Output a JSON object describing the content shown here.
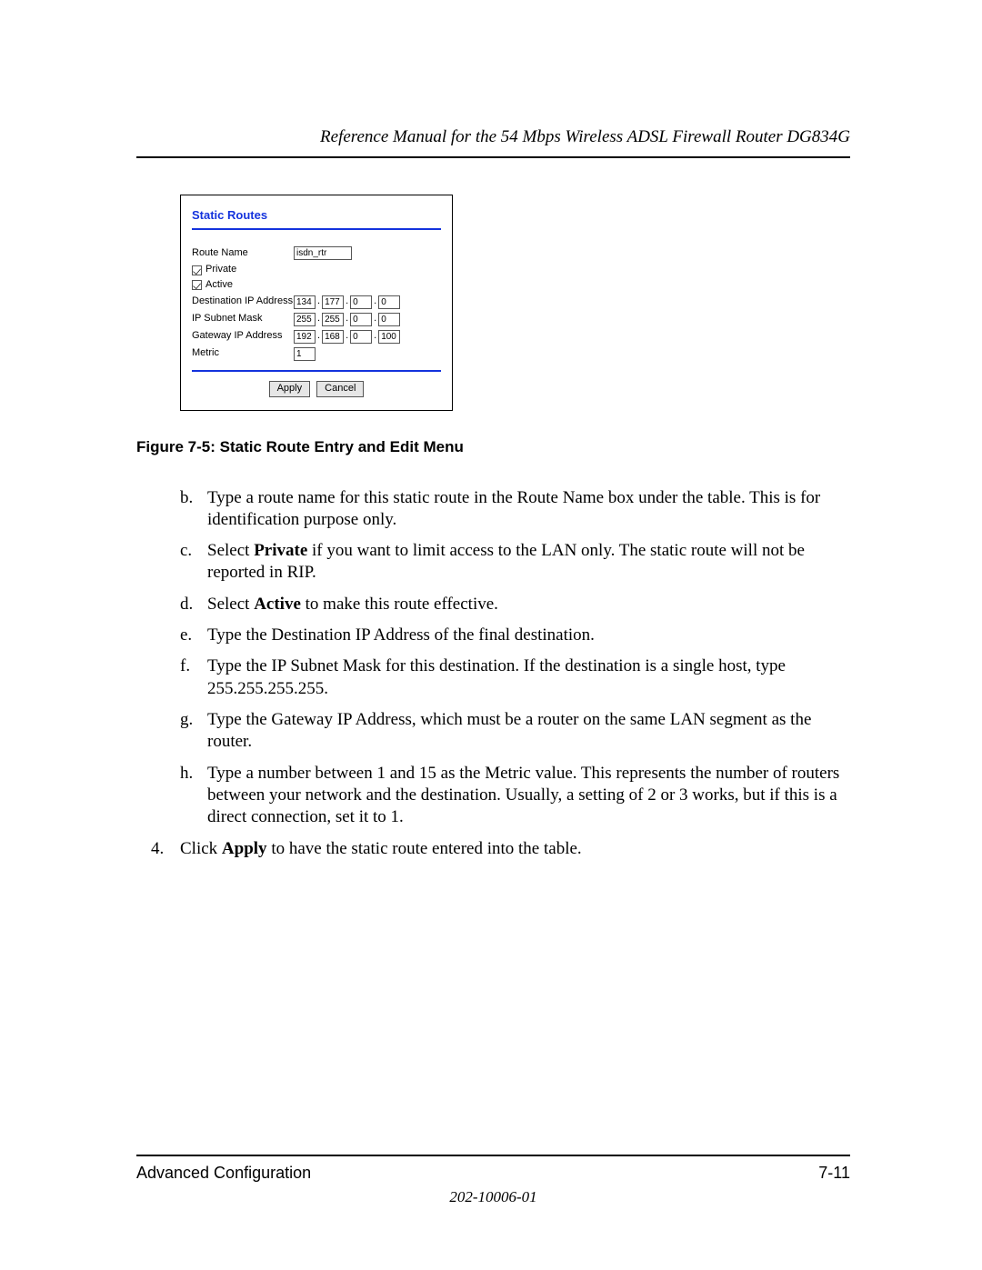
{
  "header": {
    "running_title": "Reference Manual for the 54 Mbps Wireless ADSL Firewall Router DG834G"
  },
  "ui": {
    "title": "Static Routes",
    "route_name_label": "Route Name",
    "route_name_value": "isdn_rtr",
    "private_label": "Private",
    "active_label": "Active",
    "dest_label": "Destination IP Address",
    "dest_oct": [
      "134",
      "177",
      "0",
      "0"
    ],
    "mask_label": "IP Subnet Mask",
    "mask_oct": [
      "255",
      "255",
      "0",
      "0"
    ],
    "gw_label": "Gateway IP Address",
    "gw_oct": [
      "192",
      "168",
      "0",
      "100"
    ],
    "metric_label": "Metric",
    "metric_value": "1",
    "apply_label": "Apply",
    "cancel_label": "Cancel"
  },
  "caption": "Figure 7-5:  Static Route Entry and Edit Menu",
  "steps": {
    "b": "Type a route name for this static route in the Route Name box under the table. This is for identification purpose only.",
    "c_pre": "Select ",
    "c_bold": "Private",
    "c_post": " if you want to limit access to the LAN only. The static route will not be reported in RIP.",
    "d_pre": "Select ",
    "d_bold": "Active",
    "d_post": " to make this route effective.",
    "e": "Type the Destination IP Address of the final destination.",
    "f": "Type the IP Subnet Mask for this destination. If the destination is a single host, type 255.255.255.255.",
    "g": "Type the Gateway IP Address, which must be a router on the same LAN segment as the router.",
    "h": "Type a number between 1 and 15 as the Metric value. This represents the number of routers between your network and the destination. Usually, a setting of 2 or 3 works, but if this is a direct connection, set it to 1.",
    "four_pre": "Click ",
    "four_bold": "Apply",
    "four_post": " to have the static route entered into the table."
  },
  "markers": {
    "b": "b.",
    "c": "c.",
    "d": "d.",
    "e": "e.",
    "f": "f.",
    "g": "g.",
    "h": "h.",
    "four": "4."
  },
  "footer": {
    "section": "Advanced Configuration",
    "pagenum": "7-11",
    "docnum": "202-10006-01"
  }
}
